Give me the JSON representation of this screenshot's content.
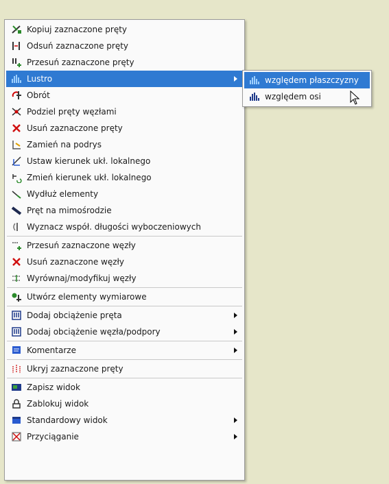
{
  "menu": {
    "items": [
      {
        "label": "Kopiuj zaznaczone pręty",
        "icon": "copy-bars-icon"
      },
      {
        "label": "Odsuń zaznaczone pręty",
        "icon": "offset-bars-icon"
      },
      {
        "label": "Przesuń zaznaczone pręty",
        "icon": "move-bars-icon"
      },
      {
        "label": "Lustro",
        "icon": "mirror-icon",
        "submenu": true,
        "highlighted": true
      },
      {
        "label": "Obrót",
        "icon": "rotate-icon"
      },
      {
        "label": "Podziel pręty węzłami",
        "icon": "split-bars-icon"
      },
      {
        "label": "Usuń zaznaczone pręty",
        "icon": "delete-bars-icon"
      },
      {
        "label": "Zamień na podrys",
        "icon": "convert-underlay-icon"
      },
      {
        "label": "Ustaw kierunek ukł. lokalnego",
        "icon": "set-local-axis-icon"
      },
      {
        "label": "Zmień kierunek ukł. lokalnego",
        "icon": "change-local-axis-icon"
      },
      {
        "label": "Wydłuż elementy",
        "icon": "extend-elements-icon"
      },
      {
        "label": "Pręt na mimośrodzie",
        "icon": "eccentric-bar-icon"
      },
      {
        "label": "Wyznacz współ. długości wyboczeniowych",
        "icon": "buckling-length-icon"
      },
      {
        "label": "Przesuń zaznaczone węzły",
        "icon": "move-nodes-icon"
      },
      {
        "label": "Usuń zaznaczone węzły",
        "icon": "delete-nodes-icon"
      },
      {
        "label": "Wyrównaj/modyfikuj węzły",
        "icon": "align-nodes-icon"
      },
      {
        "label": "Utwórz elementy wymiarowe",
        "icon": "dimension-elements-icon"
      },
      {
        "label": "Dodaj obciążenie pręta",
        "icon": "bar-load-icon",
        "submenu": true
      },
      {
        "label": "Dodaj obciążenie węzła/podpory",
        "icon": "node-load-icon",
        "submenu": true
      },
      {
        "label": "Komentarze",
        "icon": "comment-icon",
        "submenu": true
      },
      {
        "label": "Ukryj zaznaczone pręty",
        "icon": "hide-bars-icon"
      },
      {
        "label": "Zapisz widok",
        "icon": "save-view-icon"
      },
      {
        "label": "Zablokuj widok",
        "icon": "lock-view-icon"
      },
      {
        "label": "Standardowy widok",
        "icon": "standard-view-icon",
        "submenu": true
      },
      {
        "label": "Przyciąganie",
        "icon": "snap-icon",
        "submenu": true
      }
    ]
  },
  "submenu": {
    "items": [
      {
        "label": "względem płaszczyzny",
        "icon": "mirror-plane-icon",
        "highlighted": true
      },
      {
        "label": "względem osi",
        "icon": "mirror-axis-icon"
      }
    ]
  },
  "colors": {
    "highlight": "#2f7ad2",
    "background": "#e6e6c9",
    "menu": "#fafafa"
  }
}
